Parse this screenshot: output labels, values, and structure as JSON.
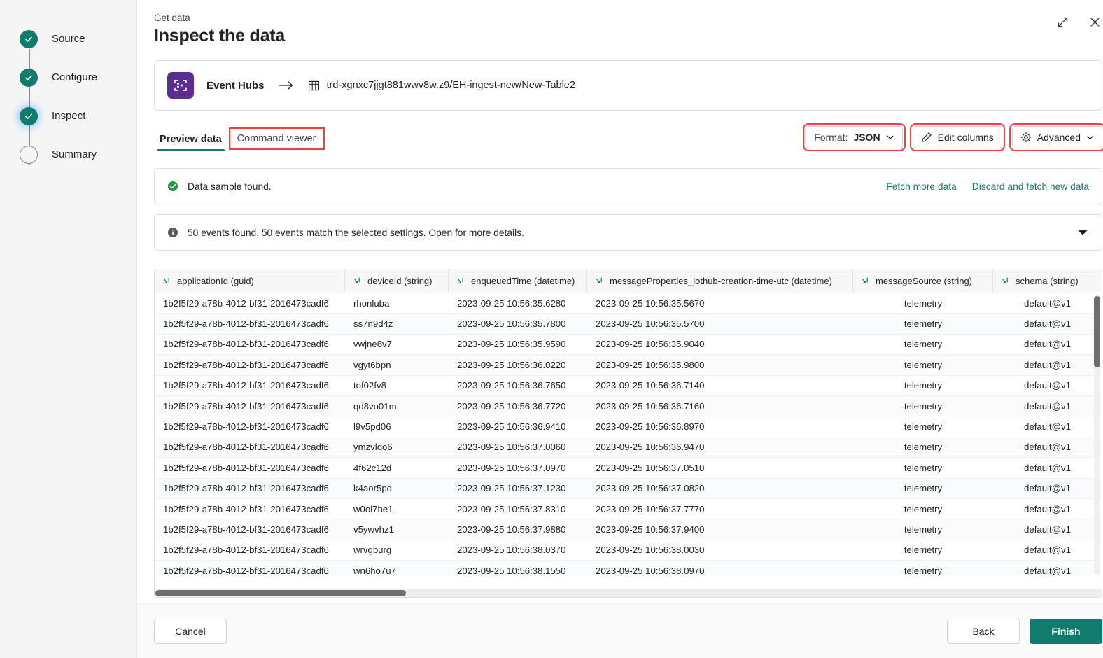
{
  "sidebar": {
    "steps": [
      {
        "label": "Source",
        "state": "done"
      },
      {
        "label": "Configure",
        "state": "done"
      },
      {
        "label": "Inspect",
        "state": "current"
      },
      {
        "label": "Summary",
        "state": "todo"
      }
    ]
  },
  "header": {
    "eyebrow": "Get data",
    "title": "Inspect the data",
    "expand_icon": "expand-icon",
    "close_icon": "close-icon"
  },
  "source": {
    "icon": "event-hubs-icon",
    "name": "Event Hubs",
    "arrow": "arrow-right-icon",
    "table_icon": "table-icon",
    "path": "trd-xgnxc7jjgt881wwv8w.z9/EH-ingest-new/New-Table2"
  },
  "tabs": [
    {
      "label": "Preview data",
      "active": true,
      "highlighted": false
    },
    {
      "label": "Command viewer",
      "active": false,
      "highlighted": true
    }
  ],
  "toolbar": {
    "format_label": "Format:",
    "format_value": "JSON",
    "edit_columns_label": "Edit columns",
    "edit_columns_icon": "pencil-icon",
    "advanced_label": "Advanced",
    "advanced_icon": "gear-icon",
    "chevron_icon": "chevron-down-icon"
  },
  "banners": {
    "success": {
      "icon": "success-check-icon",
      "text": "Data sample found.",
      "links": [
        "Fetch more data",
        "Discard and fetch new data"
      ]
    },
    "info": {
      "icon": "info-icon",
      "text": "50 events found, 50 events match the selected settings. Open for more details.",
      "caret_icon": "caret-down-icon"
    }
  },
  "table": {
    "sort_icon": "sort-icon",
    "columns": [
      "applicationId (guid)",
      "deviceId (string)",
      "enqueuedTime (datetime)",
      "messageProperties_iothub-creation-time-utc (datetime)",
      "messageSource (string)",
      "schema (string)"
    ],
    "rows": [
      [
        "1b2f5f29-a78b-4012-bf31-2016473cadf6",
        "rhonluba",
        "2023-09-25 10:56:35.6280",
        "2023-09-25 10:56:35.5670",
        "telemetry",
        "default@v1"
      ],
      [
        "1b2f5f29-a78b-4012-bf31-2016473cadf6",
        "ss7n9d4z",
        "2023-09-25 10:56:35.7800",
        "2023-09-25 10:56:35.5700",
        "telemetry",
        "default@v1"
      ],
      [
        "1b2f5f29-a78b-4012-bf31-2016473cadf6",
        "vwjne8v7",
        "2023-09-25 10:56:35.9590",
        "2023-09-25 10:56:35.9040",
        "telemetry",
        "default@v1"
      ],
      [
        "1b2f5f29-a78b-4012-bf31-2016473cadf6",
        "vgyt6bpn",
        "2023-09-25 10:56:36.0220",
        "2023-09-25 10:56:35.9800",
        "telemetry",
        "default@v1"
      ],
      [
        "1b2f5f29-a78b-4012-bf31-2016473cadf6",
        "tof02fv8",
        "2023-09-25 10:56:36.7650",
        "2023-09-25 10:56:36.7140",
        "telemetry",
        "default@v1"
      ],
      [
        "1b2f5f29-a78b-4012-bf31-2016473cadf6",
        "qd8vo01m",
        "2023-09-25 10:56:36.7720",
        "2023-09-25 10:56:36.7160",
        "telemetry",
        "default@v1"
      ],
      [
        "1b2f5f29-a78b-4012-bf31-2016473cadf6",
        "l9v5pd06",
        "2023-09-25 10:56:36.9410",
        "2023-09-25 10:56:36.8970",
        "telemetry",
        "default@v1"
      ],
      [
        "1b2f5f29-a78b-4012-bf31-2016473cadf6",
        "ymzvlqo6",
        "2023-09-25 10:56:37.0060",
        "2023-09-25 10:56:36.9470",
        "telemetry",
        "default@v1"
      ],
      [
        "1b2f5f29-a78b-4012-bf31-2016473cadf6",
        "4f62c12d",
        "2023-09-25 10:56:37.0970",
        "2023-09-25 10:56:37.0510",
        "telemetry",
        "default@v1"
      ],
      [
        "1b2f5f29-a78b-4012-bf31-2016473cadf6",
        "k4aor5pd",
        "2023-09-25 10:56:37.1230",
        "2023-09-25 10:56:37.0820",
        "telemetry",
        "default@v1"
      ],
      [
        "1b2f5f29-a78b-4012-bf31-2016473cadf6",
        "w0ol7he1",
        "2023-09-25 10:56:37.8310",
        "2023-09-25 10:56:37.7770",
        "telemetry",
        "default@v1"
      ],
      [
        "1b2f5f29-a78b-4012-bf31-2016473cadf6",
        "v5ywvhz1",
        "2023-09-25 10:56:37.9880",
        "2023-09-25 10:56:37.9400",
        "telemetry",
        "default@v1"
      ],
      [
        "1b2f5f29-a78b-4012-bf31-2016473cadf6",
        "wrvgburg",
        "2023-09-25 10:56:38.0370",
        "2023-09-25 10:56:38.0030",
        "telemetry",
        "default@v1"
      ],
      [
        "1b2f5f29-a78b-4012-bf31-2016473cadf6",
        "wn6ho7u7",
        "2023-09-25 10:56:38.1550",
        "2023-09-25 10:56:38.0970",
        "telemetry",
        "default@v1"
      ]
    ]
  },
  "footer": {
    "cancel": "Cancel",
    "back": "Back",
    "finish": "Finish"
  },
  "colors": {
    "accent_green": "#107c6e",
    "brand_purple": "#5c2d91",
    "success_green": "#1d9d35",
    "annotation_red": "#fa3c3c"
  }
}
